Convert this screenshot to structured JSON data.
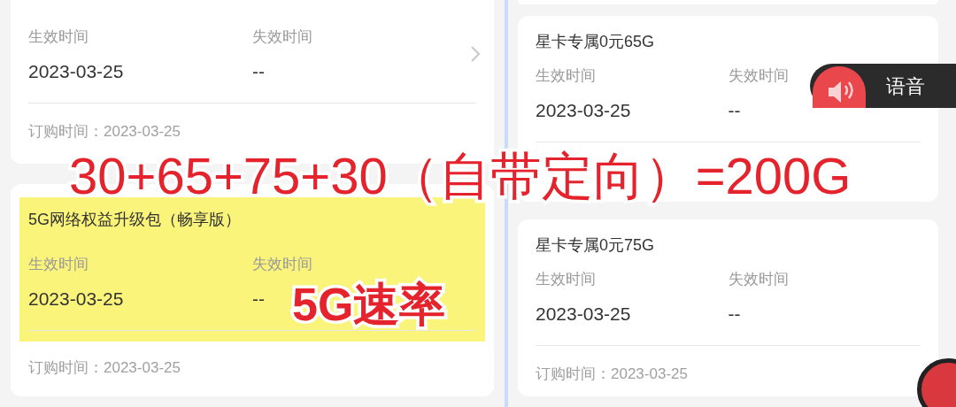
{
  "left_panel": {
    "cards": [
      {
        "highlighted": false,
        "chevron": true,
        "fields": [
          {
            "label": "生效时间",
            "value": "2023-03-25"
          },
          {
            "label": "失效时间",
            "value": "--"
          }
        ],
        "order_time": "订购时间：2023-03-25"
      },
      {
        "highlighted": true,
        "title": "5G网络权益升级包（畅享版）",
        "fields": [
          {
            "label": "生效时间",
            "value": "2023-03-25"
          },
          {
            "label": "失效时间",
            "value": "--"
          }
        ],
        "order_time": "订购时间：2023-03-25"
      }
    ]
  },
  "right_panel": {
    "cards": [
      {
        "highlighted": false,
        "title": "星卡专属0元65G",
        "fields": [
          {
            "label": "生效时间",
            "value": "2023-03-25"
          },
          {
            "label": "失效时间",
            "value": "--"
          }
        ]
      },
      {
        "highlighted": false,
        "title": "星卡专属0元75G",
        "fields": [
          {
            "label": "生效时间",
            "value": "2023-03-25"
          },
          {
            "label": "失效时间",
            "value": "--"
          }
        ],
        "order_time": "订购时间：2023-03-25"
      }
    ]
  },
  "voice_button": {
    "label": "语音"
  },
  "annotations": [
    {
      "kind": "headline",
      "text": "30+65+75+30（自带定向）=200G"
    },
    {
      "kind": "tag",
      "text": "5G速率"
    }
  ]
}
